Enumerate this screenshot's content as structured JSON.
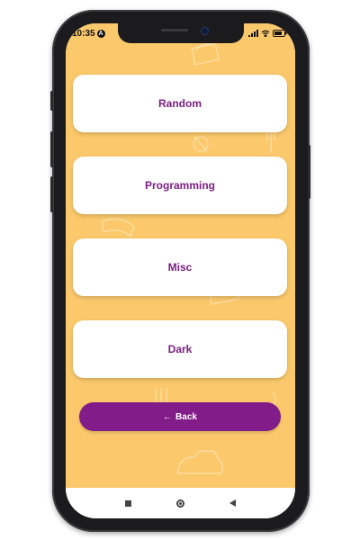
{
  "status_bar": {
    "time": "10:35",
    "badge": "A",
    "battery_icon": "battery-icon",
    "wifi_icon": "wifi-icon",
    "signal_icon": "signal-icon"
  },
  "categories": [
    {
      "label": "Random"
    },
    {
      "label": "Programming"
    },
    {
      "label": "Misc"
    },
    {
      "label": "Dark"
    }
  ],
  "back_button": {
    "arrow": "←",
    "label": "Back"
  },
  "colors": {
    "background": "#fbc96b",
    "accent": "#821c88",
    "card_text": "#7d1d86"
  },
  "nav_bar": {
    "recents_icon": "square-icon",
    "home_icon": "circle-icon",
    "back_icon": "triangle-back-icon"
  }
}
